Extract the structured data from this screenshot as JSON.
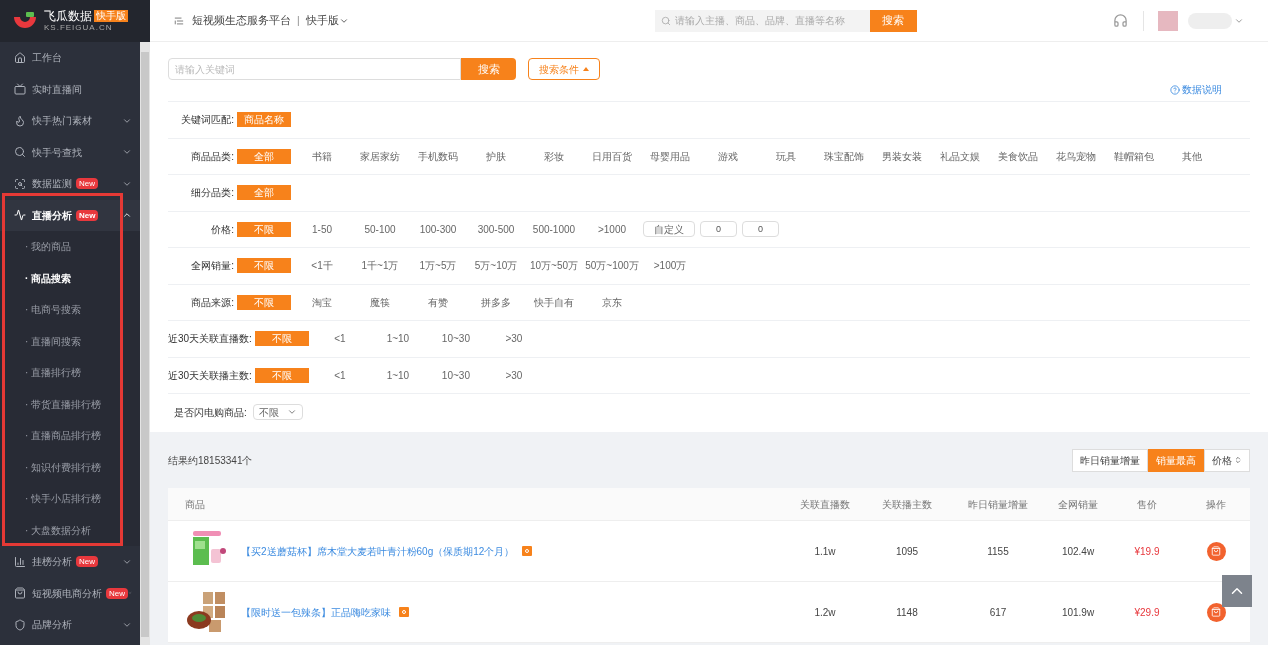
{
  "brand": {
    "name": "飞瓜数据",
    "tag": "快手版",
    "domain": "KS.FEIGUA.CN"
  },
  "topbar": {
    "platform": "短视频生态服务平台",
    "separator": "|",
    "version": "快手版",
    "search_placeholder": "请输入主播、商品、品牌、直播等名称",
    "search_button": "搜索"
  },
  "sidebar": {
    "items": [
      {
        "label": "工作台"
      },
      {
        "label": "实时直播间"
      },
      {
        "label": "快手热门素材",
        "expanded": false
      },
      {
        "label": "快手号查找",
        "expanded": false
      },
      {
        "label": "数据监测",
        "badge": "New",
        "expanded": false
      },
      {
        "label": "直播分析",
        "badge": "New",
        "expanded": true,
        "children": [
          {
            "label": "· 我的商品",
            "selected": false
          },
          {
            "label": "· 商品搜索",
            "selected": true
          },
          {
            "label": "· 电商号搜索",
            "selected": false
          },
          {
            "label": "· 直播间搜索",
            "selected": false
          },
          {
            "label": "· 直播排行榜",
            "selected": false
          },
          {
            "label": "· 带货直播排行榜",
            "selected": false
          },
          {
            "label": "· 直播商品排行榜",
            "selected": false
          },
          {
            "label": "· 知识付费排行榜",
            "selected": false
          },
          {
            "label": "· 快手小店排行榜",
            "selected": false
          },
          {
            "label": "· 大盘数据分析",
            "selected": false
          }
        ]
      },
      {
        "label": "挂榜分析",
        "badge": "New",
        "expanded": false
      },
      {
        "label": "短视频电商分析",
        "badge": "New",
        "expanded": false
      },
      {
        "label": "品牌分析",
        "expanded": false
      }
    ]
  },
  "search": {
    "placeholder": "请输入关键词",
    "button": "搜索",
    "conditions_button": "搜索条件",
    "help_link": "数据说明"
  },
  "filters": [
    {
      "kind": "options",
      "label": "关键词匹配:",
      "options": [
        {
          "label": "商品名称",
          "selected": true
        }
      ]
    },
    {
      "kind": "options",
      "label": "商品品类:",
      "options": [
        {
          "label": "全部",
          "selected": true
        },
        {
          "label": "书籍",
          "selected": false
        },
        {
          "label": "家居家纺",
          "selected": false
        },
        {
          "label": "手机数码",
          "selected": false
        },
        {
          "label": "护肤",
          "selected": false
        },
        {
          "label": "彩妆",
          "selected": false
        },
        {
          "label": "日用百货",
          "selected": false
        },
        {
          "label": "母婴用品",
          "selected": false
        },
        {
          "label": "游戏",
          "selected": false
        },
        {
          "label": "玩具",
          "selected": false
        },
        {
          "label": "珠宝配饰",
          "selected": false
        },
        {
          "label": "男装女装",
          "selected": false
        },
        {
          "label": "礼品文娱",
          "selected": false
        },
        {
          "label": "美食饮品",
          "selected": false
        },
        {
          "label": "花鸟宠物",
          "selected": false
        },
        {
          "label": "鞋帽箱包",
          "selected": false
        },
        {
          "label": "其他",
          "selected": false
        }
      ]
    },
    {
      "kind": "options",
      "label": "细分品类:",
      "options": [
        {
          "label": "全部",
          "selected": true
        }
      ]
    },
    {
      "kind": "options",
      "label": "价格:",
      "options": [
        {
          "label": "不限",
          "selected": true
        },
        {
          "label": "1-50",
          "selected": false
        },
        {
          "label": "50-100",
          "selected": false
        },
        {
          "label": "100-300",
          "selected": false
        },
        {
          "label": "300-500",
          "selected": false
        },
        {
          "label": "500-1000",
          "selected": false
        },
        {
          "label": ">1000",
          "selected": false
        }
      ],
      "custom": {
        "button": "自定义",
        "min": "0",
        "max": "0"
      }
    },
    {
      "kind": "options",
      "label": "全网销量:",
      "options": [
        {
          "label": "不限",
          "selected": true
        },
        {
          "label": "<1千",
          "selected": false
        },
        {
          "label": "1千~1万",
          "selected": false
        },
        {
          "label": "1万~5万",
          "selected": false
        },
        {
          "label": "5万~10万",
          "selected": false
        },
        {
          "label": "10万~50万",
          "selected": false
        },
        {
          "label": "50万~100万",
          "selected": false
        },
        {
          "label": ">100万",
          "selected": false
        }
      ]
    },
    {
      "kind": "options",
      "label": "商品来源:",
      "options": [
        {
          "label": "不限",
          "selected": true
        },
        {
          "label": "淘宝",
          "selected": false
        },
        {
          "label": "魔筷",
          "selected": false
        },
        {
          "label": "有赞",
          "selected": false
        },
        {
          "label": "拼多多",
          "selected": false
        },
        {
          "label": "快手自有",
          "selected": false
        },
        {
          "label": "京东",
          "selected": false
        }
      ]
    },
    {
      "kind": "options",
      "label": "近30天关联直播数:",
      "options": [
        {
          "label": "不限",
          "selected": true
        },
        {
          "label": "<1",
          "selected": false
        },
        {
          "label": "1~10",
          "selected": false
        },
        {
          "label": "10~30",
          "selected": false
        },
        {
          "label": ">30",
          "selected": false
        }
      ]
    },
    {
      "kind": "options",
      "label": "近30天关联播主数:",
      "options": [
        {
          "label": "不限",
          "selected": true
        },
        {
          "label": "<1",
          "selected": false
        },
        {
          "label": "1~10",
          "selected": false
        },
        {
          "label": "10~30",
          "selected": false
        },
        {
          "label": ">30",
          "selected": false
        }
      ]
    },
    {
      "kind": "select",
      "label": "是否闪电购商品:",
      "value": "不限"
    }
  ],
  "results": {
    "count": "结果约18153341个",
    "sorts": [
      {
        "label": "昨日销量增量",
        "selected": false
      },
      {
        "label": "销量最高",
        "selected": true
      },
      {
        "label": "价格",
        "selected": false
      }
    ]
  },
  "table": {
    "columns": [
      "商品",
      "关联直播数",
      "关联播主数",
      "昨日销量增量",
      "全网销量",
      "售价",
      "操作"
    ],
    "rows": [
      {
        "title": "【买2送蘑菇杯】席木堂大麦若叶青汁粉60g（保质期12个月）",
        "live_count": "1.1w",
        "streamer_count": "1095",
        "yesterday_growth": "1155",
        "total_sales": "102.4w",
        "price": "¥19.9"
      },
      {
        "title": "【限时送一包辣条】正品嗨吃家味",
        "live_count": "1.2w",
        "streamer_count": "1148",
        "yesterday_growth": "617",
        "total_sales": "101.9w",
        "price": "¥29.9"
      }
    ]
  }
}
